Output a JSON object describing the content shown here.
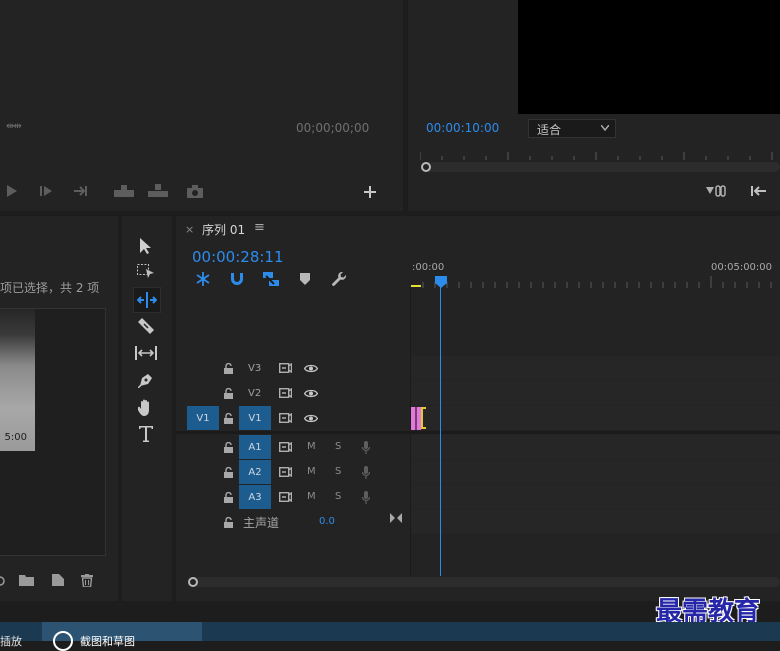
{
  "source_monitor": {
    "timecode": "00;00;00;00"
  },
  "program_monitor": {
    "timecode": "00:00:10:00",
    "fit_label": "适合"
  },
  "project_panel": {
    "selection_text": "项已选择，共 2 项",
    "thumb_duration": "5:00"
  },
  "timeline": {
    "sequence_title": "序列 01",
    "close_glyph": "×",
    "menu_glyph": "≡",
    "timecode": "00:00:28:11",
    "ruler_start": ":00:00",
    "ruler_end": "00:05:00:00",
    "video_tracks": [
      {
        "name": "V3",
        "source": ""
      },
      {
        "name": "V2",
        "source": ""
      },
      {
        "name": "V1",
        "source": "V1"
      }
    ],
    "audio_tracks": [
      {
        "name": "A1",
        "m": "M",
        "s": "S"
      },
      {
        "name": "A2",
        "m": "M",
        "s": "S"
      },
      {
        "name": "A3",
        "m": "M",
        "s": "S"
      }
    ],
    "master": {
      "label": "主声道",
      "value": "0.0"
    }
  },
  "watermark": "最需教育",
  "taskbar": {
    "left_partial": "插放",
    "item_label": "截图和草图"
  },
  "colors": {
    "accent_blue": "#2d8ceb",
    "clip_pink": "#e07ad8",
    "clip_yellow": "#e6c830",
    "target_blue": "#1d5c8f"
  }
}
